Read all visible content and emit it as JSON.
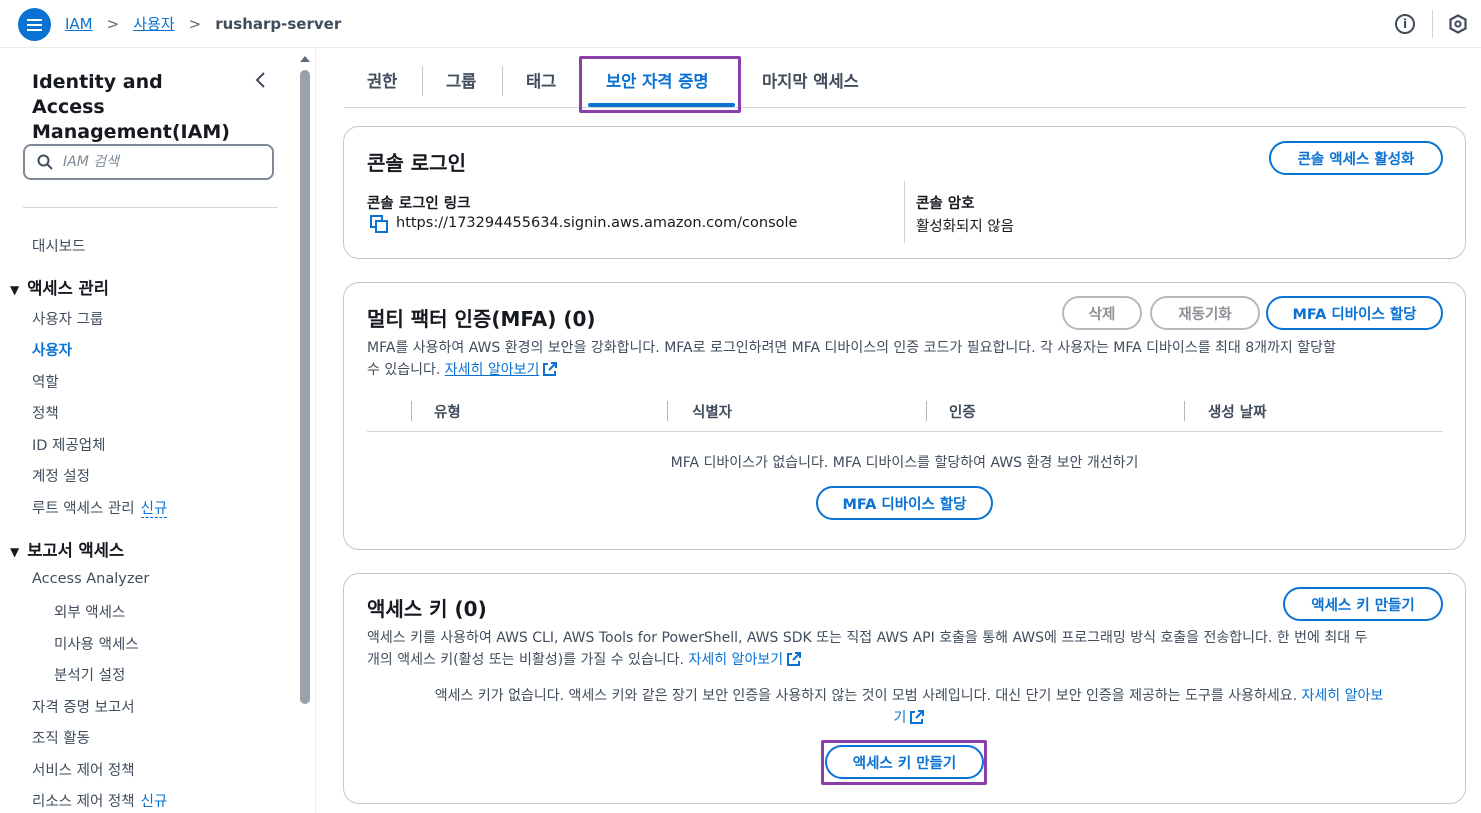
{
  "topbar": {
    "breadcrumb": [
      "IAM",
      "사용자",
      "rusharp-server"
    ],
    "info_label": "i"
  },
  "sidebar": {
    "title": "Identity and Access Management(IAM)",
    "search_placeholder": "IAM 검색",
    "dashboard": "대시보드",
    "section_access": "액세스 관리",
    "access_items": [
      "사용자 그룹",
      "사용자",
      "역할",
      "정책",
      "ID 제공업체",
      "계정 설정",
      "루트 액세스 관리"
    ],
    "section_reports": "보고서 액세스",
    "report_items": [
      "Access Analyzer",
      "외부 액세스",
      "미사용 액세스",
      "분석기 설정",
      "자격 증명 보고서",
      "조직 활동",
      "서비스 제어 정책",
      "리소스 제어 정책"
    ],
    "new_badge": "신규"
  },
  "tabs": [
    "권한",
    "그룹",
    "태그",
    "보안 자격 증명",
    "마지막 액세스"
  ],
  "console_login": {
    "title": "콘솔 로그인",
    "enable_button": "콘솔 액세스 활성화",
    "link_label": "콘솔 로그인 링크",
    "link_value": "https://173294455634.signin.aws.amazon.com/console",
    "password_label": "콘솔 암호",
    "password_value": "활성화되지 않음"
  },
  "mfa": {
    "title": "멀티 팩터 인증(MFA) (0)",
    "delete_button": "삭제",
    "resync_button": "재동기화",
    "assign_button": "MFA 디바이스 할당",
    "description_1": "MFA를 사용하여 AWS 환경의 보안을 강화합니다. MFA로 로그인하려면 MFA 디바이스의 인증 코드가 필요합니다. 각 사용자는 MFA 디바이스를 최대 8개까지 할당할",
    "description_2": "수 있습니다.",
    "learn_more": "자세히 알아보기",
    "columns": [
      "유형",
      "식별자",
      "인증",
      "생성 날짜"
    ],
    "empty_text": "MFA 디바이스가 없습니다. MFA 디바이스를 할당하여 AWS 환경 보안 개선하기",
    "empty_button": "MFA 디바이스 할당"
  },
  "access_keys": {
    "title": "액세스 키 (0)",
    "create_button": "액세스 키 만들기",
    "description_1": "액세스 키를 사용하여 AWS CLI, AWS Tools for PowerShell, AWS SDK 또는 직접 AWS API 호출을 통해 AWS에 프로그래밍 방식 호출을 전송합니다. 한 번에 최대 두",
    "description_2": "개의 액세스 키(활성 또는 비활성)를 가질 수 있습니다.",
    "learn_more": "자세히 알아보기",
    "empty_text_1": "액세스 키가 없습니다. 액세스 키와 같은 장기 보안 인증을 사용하지 않는 것이 모범 사례입니다. 대신 단기 보안 인증을 제공하는 도구를 사용하세요.",
    "empty_link_1": "자세히 알아보",
    "empty_link_2": "기",
    "empty_button": "액세스 키 만들기"
  },
  "colors": {
    "accent": "#0972d3",
    "highlight": "#8a3ea8"
  }
}
